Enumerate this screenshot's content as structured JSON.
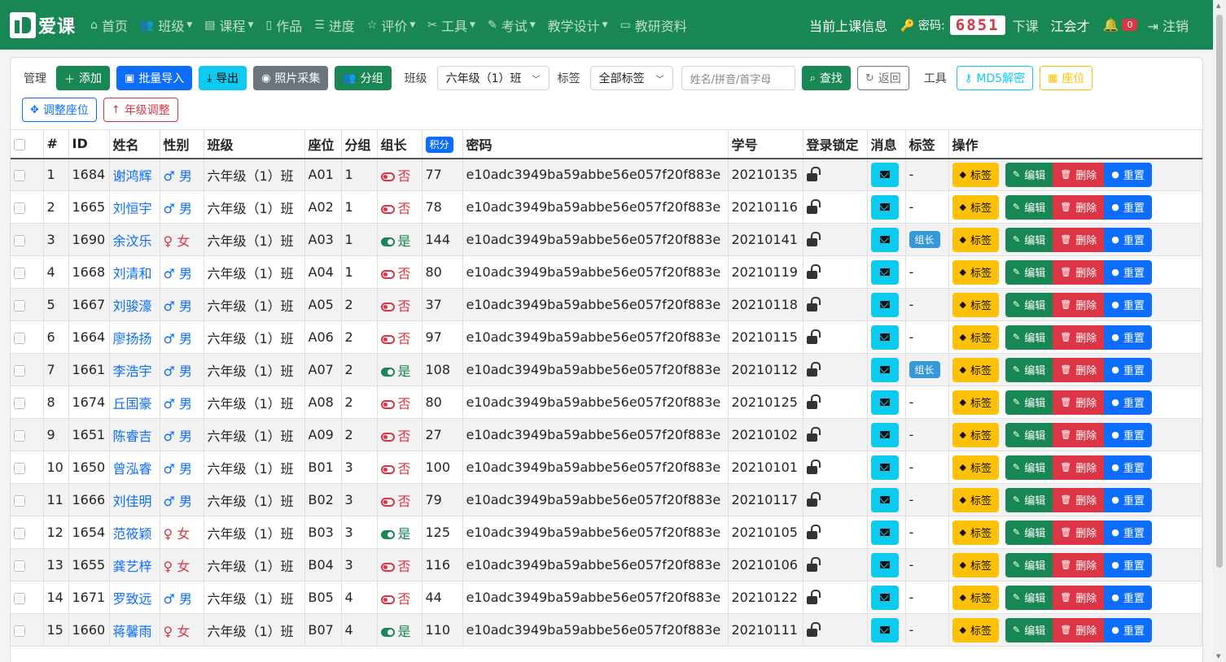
{
  "brand": {
    "name": "爱课"
  },
  "nav": [
    {
      "icon": "home-icon",
      "glyph": "⌂",
      "label": "首页",
      "caret": false
    },
    {
      "icon": "users-icon",
      "glyph": "👥",
      "label": "班级",
      "caret": true
    },
    {
      "icon": "book-icon",
      "glyph": "▤",
      "label": "课程",
      "caret": true
    },
    {
      "icon": "file-icon",
      "glyph": "▯",
      "label": "作品",
      "caret": false
    },
    {
      "icon": "list-icon",
      "glyph": "☰",
      "label": "进度",
      "caret": false
    },
    {
      "icon": "star-icon",
      "glyph": "☆",
      "label": "评价",
      "caret": true
    },
    {
      "icon": "tools-icon",
      "glyph": "✂",
      "label": "工具",
      "caret": true
    },
    {
      "icon": "edit-icon",
      "glyph": "✎",
      "label": "考试",
      "caret": true
    },
    {
      "icon": "",
      "glyph": "",
      "label": "教学设计",
      "caret": true
    },
    {
      "icon": "doc-icon",
      "glyph": "▭",
      "label": "教研资料",
      "caret": false
    }
  ],
  "nav_right": {
    "current_class": "当前上课信息",
    "password_label": "密码:",
    "password_code": "6851",
    "end_class": "下课",
    "user": "江会才",
    "notifications": "0",
    "logout": "注销"
  },
  "toolbar": {
    "manage_label": "管理",
    "add": "添加",
    "batch_import": "批量导入",
    "export": "导出",
    "photo": "照片采集",
    "group": "分组",
    "class_label": "班级",
    "class_value": "六年级（1）班",
    "tag_label": "标签",
    "tag_value": "全部标签",
    "search_placeholder": "姓名/拼音/首字母",
    "search": "查找",
    "back": "返回",
    "tools_label": "工具",
    "md5": "MD5解密",
    "seat": "座位",
    "adjust_seat": "调整座位",
    "grade_adjust": "年级调整"
  },
  "table": {
    "headers": {
      "num": "#",
      "id": "ID",
      "name": "姓名",
      "gender": "性别",
      "class": "班级",
      "seat": "座位",
      "group": "分组",
      "leader": "组长",
      "score": "积分",
      "password": "密码",
      "student_no": "学号",
      "lock": "登录锁定",
      "message": "消息",
      "tag": "标签",
      "ops": "操作"
    },
    "ops": {
      "tag": "标签",
      "edit": "编辑",
      "delete": "删除",
      "reset": "重置"
    },
    "rows": [
      {
        "num": "1",
        "id": "1684",
        "name": "谢鸿辉",
        "gender": "男",
        "class": "六年级（1）班",
        "seat": "A01",
        "group": "1",
        "leader": "否",
        "score": "77",
        "password": "e10adc3949ba59abbe56e057f20f883e",
        "student_no": "20210135",
        "tag": "-"
      },
      {
        "num": "2",
        "id": "1665",
        "name": "刘恒宇",
        "gender": "男",
        "class": "六年级（1）班",
        "seat": "A02",
        "group": "1",
        "leader": "否",
        "score": "78",
        "password": "e10adc3949ba59abbe56e057f20f883e",
        "student_no": "20210116",
        "tag": "-"
      },
      {
        "num": "3",
        "id": "1690",
        "name": "余汶乐",
        "gender": "女",
        "class": "六年级（1）班",
        "seat": "A03",
        "group": "1",
        "leader": "是",
        "score": "144",
        "password": "e10adc3949ba59abbe56e057f20f883e",
        "student_no": "20210141",
        "tag": "组长"
      },
      {
        "num": "4",
        "id": "1668",
        "name": "刘清和",
        "gender": "男",
        "class": "六年级（1）班",
        "seat": "A04",
        "group": "1",
        "leader": "否",
        "score": "80",
        "password": "e10adc3949ba59abbe56e057f20f883e",
        "student_no": "20210119",
        "tag": "-"
      },
      {
        "num": "5",
        "id": "1667",
        "name": "刘骏濠",
        "gender": "男",
        "class": "六年级（1）班",
        "seat": "A05",
        "group": "2",
        "leader": "否",
        "score": "37",
        "password": "e10adc3949ba59abbe56e057f20f883e",
        "student_no": "20210118",
        "tag": "-"
      },
      {
        "num": "6",
        "id": "1664",
        "name": "廖扬扬",
        "gender": "男",
        "class": "六年级（1）班",
        "seat": "A06",
        "group": "2",
        "leader": "否",
        "score": "97",
        "password": "e10adc3949ba59abbe56e057f20f883e",
        "student_no": "20210115",
        "tag": "-"
      },
      {
        "num": "7",
        "id": "1661",
        "name": "李浩宇",
        "gender": "男",
        "class": "六年级（1）班",
        "seat": "A07",
        "group": "2",
        "leader": "是",
        "score": "108",
        "password": "e10adc3949ba59abbe56e057f20f883e",
        "student_no": "20210112",
        "tag": "组长"
      },
      {
        "num": "8",
        "id": "1674",
        "name": "丘国豪",
        "gender": "男",
        "class": "六年级（1）班",
        "seat": "A08",
        "group": "2",
        "leader": "否",
        "score": "80",
        "password": "e10adc3949ba59abbe56e057f20f883e",
        "student_no": "20210125",
        "tag": "-"
      },
      {
        "num": "9",
        "id": "1651",
        "name": "陈睿吉",
        "gender": "男",
        "class": "六年级（1）班",
        "seat": "A09",
        "group": "2",
        "leader": "否",
        "score": "27",
        "password": "e10adc3949ba59abbe56e057f20f883e",
        "student_no": "20210102",
        "tag": "-"
      },
      {
        "num": "10",
        "id": "1650",
        "name": "曾泓睿",
        "gender": "男",
        "class": "六年级（1）班",
        "seat": "B01",
        "group": "3",
        "leader": "否",
        "score": "100",
        "password": "e10adc3949ba59abbe56e057f20f883e",
        "student_no": "20210101",
        "tag": "-"
      },
      {
        "num": "11",
        "id": "1666",
        "name": "刘佳明",
        "gender": "男",
        "class": "六年级（1）班",
        "seat": "B02",
        "group": "3",
        "leader": "否",
        "score": "79",
        "password": "e10adc3949ba59abbe56e057f20f883e",
        "student_no": "20210117",
        "tag": "-"
      },
      {
        "num": "12",
        "id": "1654",
        "name": "范筱颖",
        "gender": "女",
        "class": "六年级（1）班",
        "seat": "B03",
        "group": "3",
        "leader": "是",
        "score": "125",
        "password": "e10adc3949ba59abbe56e057f20f883e",
        "student_no": "20210105",
        "tag": "-"
      },
      {
        "num": "13",
        "id": "1655",
        "name": "龚艺梓",
        "gender": "女",
        "class": "六年级（1）班",
        "seat": "B04",
        "group": "3",
        "leader": "否",
        "score": "116",
        "password": "e10adc3949ba59abbe56e057f20f883e",
        "student_no": "20210106",
        "tag": "-"
      },
      {
        "num": "14",
        "id": "1671",
        "name": "罗致远",
        "gender": "男",
        "class": "六年级（1）班",
        "seat": "B05",
        "group": "4",
        "leader": "否",
        "score": "44",
        "password": "e10adc3949ba59abbe56e057f20f883e",
        "student_no": "20210122",
        "tag": "-"
      },
      {
        "num": "15",
        "id": "1660",
        "name": "蒋馨雨",
        "gender": "女",
        "class": "六年级（1）班",
        "seat": "B07",
        "group": "4",
        "leader": "是",
        "score": "110",
        "password": "e10adc3949ba59abbe56e057f20f883e",
        "student_no": "20210111",
        "tag": "-"
      }
    ]
  },
  "colors": {
    "primary_green": "#198754",
    "primary_blue": "#0d6efd",
    "danger": "#dc3545",
    "warning": "#ffc107",
    "info": "#0dcaf0"
  }
}
